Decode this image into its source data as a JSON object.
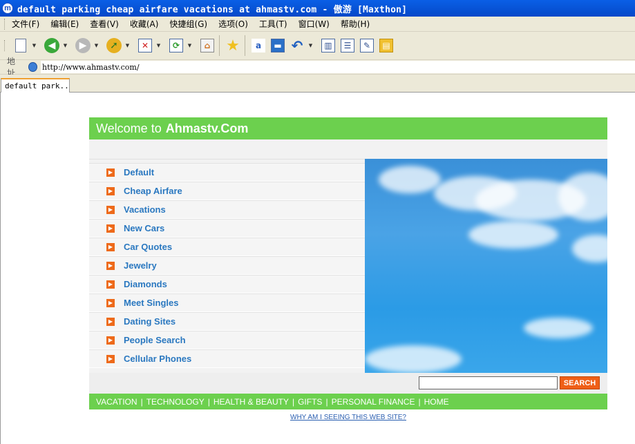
{
  "window": {
    "title": "default parking cheap airfare vacations at ahmastv.com - 傲游 [Maxthon]",
    "logo": "m"
  },
  "menu": [
    "文件(F)",
    "编辑(E)",
    "查看(V)",
    "收藏(A)",
    "快捷组(G)",
    "选项(O)",
    "工具(T)",
    "窗口(W)",
    "帮助(H)"
  ],
  "toolbar": {
    "icons": [
      "new-page-icon",
      "back-icon",
      "forward-icon",
      "up-icon",
      "stop-icon",
      "refresh-icon",
      "home-icon",
      "favorites-icon",
      "translate-icon",
      "screen-icon",
      "undo-icon",
      "columns-icon",
      "sidebar-icon",
      "edit-icon",
      "group-icon"
    ]
  },
  "address": {
    "label": "地址",
    "url": "http://www.ahmastv.com/"
  },
  "tabs": [
    {
      "label": "default park..."
    }
  ],
  "site": {
    "header_prefix": "Welcome to",
    "header_brand": "Ahmastv.Com",
    "links": [
      "Default",
      "Cheap Airfare",
      "Vacations",
      "New Cars",
      "Car Quotes",
      "Jewelry",
      "Diamonds",
      "Meet Singles",
      "Dating Sites",
      "People Search",
      "Cellular Phones"
    ],
    "search_button": "SEARCH",
    "footer_links": [
      "VACATION",
      "TECHNOLOGY",
      "HEALTH & BEAUTY",
      "GIFTS",
      "PERSONAL FINANCE",
      "HOME"
    ],
    "why_link": "WHY AM I SEEING THIS WEB SITE?"
  },
  "colors": {
    "brand_green": "#6cd04e",
    "link_blue": "#2a78c0",
    "accent_orange": "#ef5f17"
  }
}
